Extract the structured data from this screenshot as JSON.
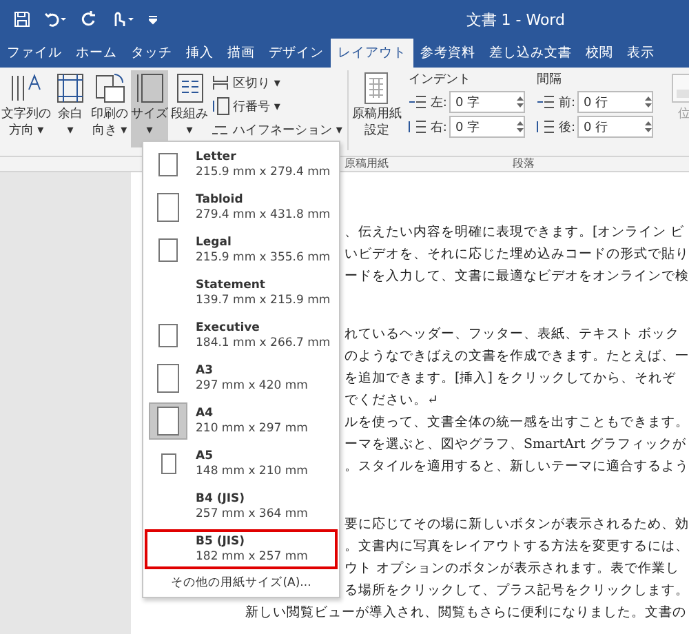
{
  "window": {
    "title": "文書 1 - Word"
  },
  "tabs": [
    {
      "label": "ファイル",
      "selected": false
    },
    {
      "label": "ホーム",
      "selected": false
    },
    {
      "label": "タッチ",
      "selected": false
    },
    {
      "label": "挿入",
      "selected": false
    },
    {
      "label": "描画",
      "selected": false
    },
    {
      "label": "デザイン",
      "selected": false
    },
    {
      "label": "レイアウト",
      "selected": true
    },
    {
      "label": "参考資料",
      "selected": false
    },
    {
      "label": "差し込み文書",
      "selected": false
    },
    {
      "label": "校閲",
      "selected": false
    },
    {
      "label": "表示",
      "selected": false
    }
  ],
  "ribbon": {
    "large_buttons": [
      {
        "kind": "direction",
        "lines": [
          "文字列の",
          "方向 ▾"
        ],
        "pressed": false
      },
      {
        "kind": "margins",
        "lines": [
          "余白",
          "▾"
        ],
        "pressed": false
      },
      {
        "kind": "orientation",
        "lines": [
          "印刷の",
          "向き ▾"
        ],
        "pressed": false
      },
      {
        "kind": "size",
        "lines": [
          "サイズ",
          "▾"
        ],
        "pressed": true
      },
      {
        "kind": "columns",
        "lines": [
          "段組み",
          "▾"
        ],
        "pressed": false
      }
    ],
    "small_buttons": [
      {
        "kind": "breaks",
        "label": "区切り ▾"
      },
      {
        "kind": "linenumbers",
        "label": "行番号 ▾"
      },
      {
        "kind": "hyphen",
        "label": "ハイフネーション ▾"
      }
    ],
    "genko": {
      "lines": [
        "原稿用紙",
        "設定"
      ]
    },
    "indent": {
      "title": "インデント",
      "fields": [
        {
          "kind": "left",
          "label": "左:",
          "value": "0 字"
        },
        {
          "kind": "right",
          "label": "右:",
          "value": "0 字"
        }
      ]
    },
    "spacing": {
      "title": "間隔",
      "fields": [
        {
          "kind": "before",
          "label": "前:",
          "value": "0 行"
        },
        {
          "kind": "after",
          "label": "後:",
          "value": "0 行"
        }
      ]
    },
    "position": {
      "label": "位",
      "disabled": true
    },
    "group_labels": [
      "原稿用紙",
      "段落"
    ]
  },
  "size_menu": {
    "items": [
      {
        "name": "Letter",
        "dims": "215.9 mm x 279.4 mm",
        "kind": "short",
        "selected": false,
        "highlighted": false
      },
      {
        "name": "Tabloid",
        "dims": "279.4 mm x 431.8 mm",
        "kind": "tall",
        "selected": false,
        "highlighted": false
      },
      {
        "name": "Legal",
        "dims": "215.9 mm x 355.6 mm",
        "kind": "short",
        "selected": false,
        "highlighted": false
      },
      {
        "name": "Statement",
        "dims": "139.7 mm x 215.9 mm",
        "kind": "blank",
        "selected": false,
        "highlighted": false
      },
      {
        "name": "Executive",
        "dims": "184.1 mm x 266.7 mm",
        "kind": "short",
        "selected": false,
        "highlighted": false
      },
      {
        "name": "A3",
        "dims": "297 mm x 420 mm",
        "kind": "tall",
        "selected": false,
        "highlighted": false
      },
      {
        "name": "A4",
        "dims": "210 mm x 297 mm",
        "kind": "tall",
        "selected": true,
        "highlighted": false
      },
      {
        "name": "A5",
        "dims": "148 mm x 210 mm",
        "kind": "small",
        "selected": false,
        "highlighted": false
      },
      {
        "name": "B4 (JIS)",
        "dims": "257 mm x 364 mm",
        "kind": "blank",
        "selected": false,
        "highlighted": false
      },
      {
        "name": "B5 (JIS)",
        "dims": "182 mm x 257 mm",
        "kind": "blank",
        "selected": false,
        "highlighted": true
      }
    ],
    "more": "その他の用紙サイズ(A)..."
  },
  "document": {
    "paragraphs": [
      [
        "、伝えたい内容を明確に表現できます。[オンライン ビ",
        "いビデオを、それに応じた埋め込みコードの形式で貼り",
        "ードを入力して、文書に最適なビデオをオンラインで検"
      ],
      [
        "れているヘッダー、フッター、表紙、テキスト ボック",
        "のようなできばえの文書を作成できます。たとえば、一",
        "を追加できます。[挿入] をクリックしてから、それぞ",
        "でください。↵",
        "ルを使って、文書全体の統一感を出すこともできます。",
        "ーマを選ぶと、図やグラフ、SmartArt グラフィックが",
        "。スタイルを適用すると、新しいテーマに適合するよう"
      ],
      [
        "要に応じてその場に新しいボタンが表示されるため、効",
        "。文書内に写真をレイアウトする方法を変更するには、",
        "ウト オプションのボタンが表示されます。表で作業し",
        "る場所をクリックして、プラス記号をクリックします。"
      ]
    ],
    "last_line": "新しい閲覧ビューが導入され、閲覧もさらに便利になりました。文書の"
  }
}
